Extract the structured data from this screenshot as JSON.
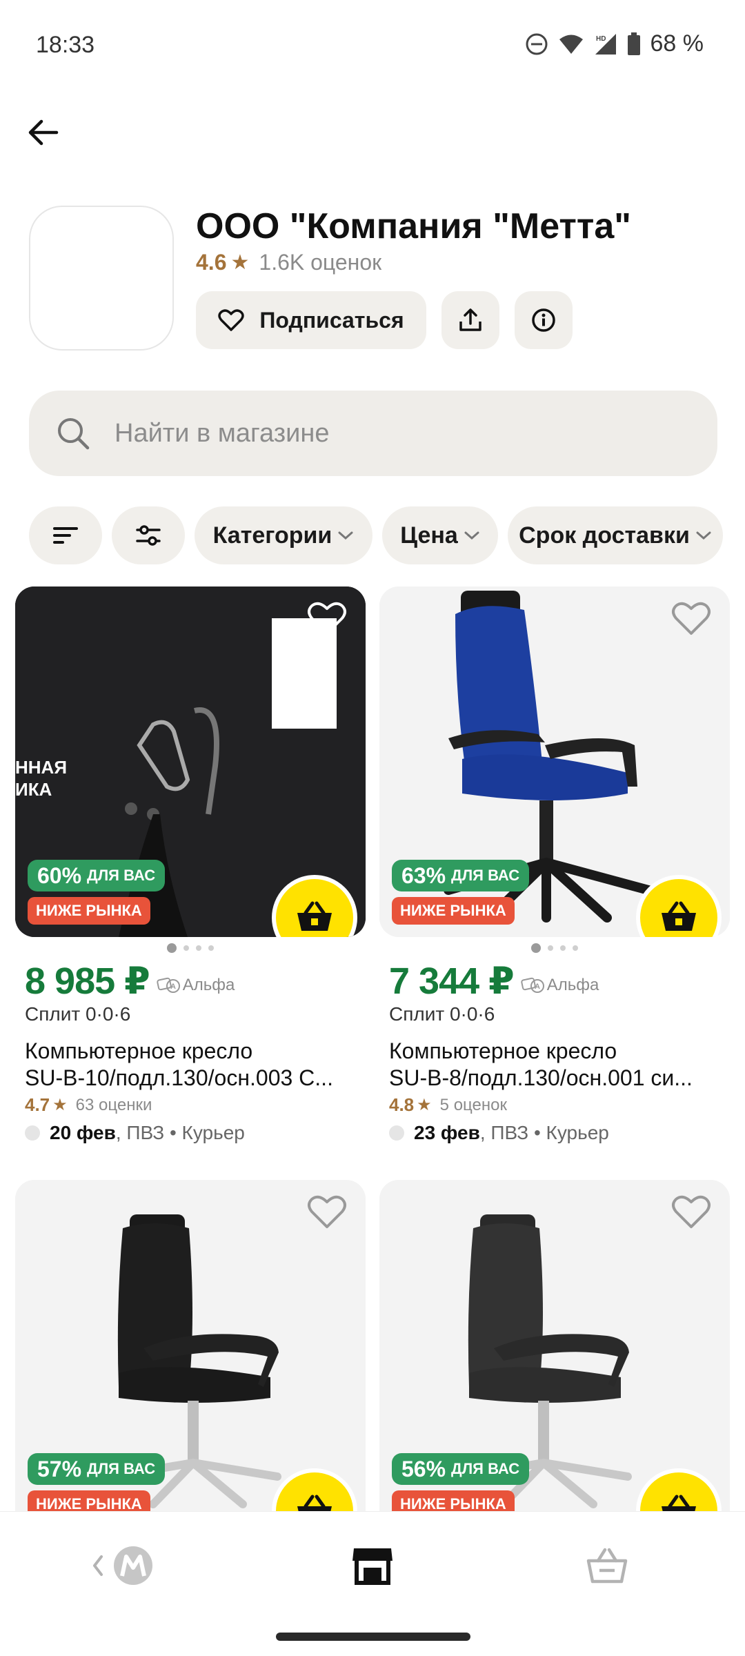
{
  "status_bar": {
    "time": "18:33",
    "battery": "68 %"
  },
  "shop": {
    "name": "ООО \"Компания \"Метта\"",
    "rating": "4.6",
    "rating_count": "1.6K оценок",
    "subscribe_label": "Подписаться"
  },
  "search": {
    "placeholder": "Найти в магазине"
  },
  "filters": [
    "Категории",
    "Цена",
    "Срок доставки"
  ],
  "products": [
    {
      "discount": "60%",
      "for_you": "ДЛЯ ВАС",
      "market": "НИЖЕ РЫНКА",
      "price": "8 985 ₽",
      "bank": "Альфа",
      "split": "Сплит 0·0·6",
      "title_1": "Компьютерное кресло",
      "title_2": "SU-B-10/подл.130/осн.003 С...",
      "rating": "4.7",
      "rating_count": "63 оценки",
      "delivery_date": "20 фев",
      "delivery_methods": ", ПВЗ • Курьер",
      "promo_text_1": "ННАЯ",
      "promo_text_2": "ИКА"
    },
    {
      "discount": "63%",
      "for_you": "ДЛЯ ВАС",
      "market": "НИЖЕ РЫНКА",
      "price": "7 344 ₽",
      "bank": "Альфа",
      "split": "Сплит 0·0·6",
      "title_1": "Компьютерное кресло",
      "title_2": "SU-B-8/подл.130/осн.001 си...",
      "rating": "4.8",
      "rating_count": "5 оценок",
      "delivery_date": "23 фев",
      "delivery_methods": ", ПВЗ • Курьер"
    },
    {
      "discount": "57%",
      "for_you": "ДЛЯ ВАС",
      "market": "НИЖЕ РЫНКА"
    },
    {
      "discount": "56%",
      "for_you": "ДЛЯ ВАС",
      "market": "НИЖЕ РЫНКА"
    }
  ],
  "colors": {
    "accent_yellow": "#ffe200",
    "price_green": "#167b3b",
    "badge_green": "#2f9b5f",
    "badge_red": "#e8533a",
    "rating_gold": "#a4733a"
  }
}
